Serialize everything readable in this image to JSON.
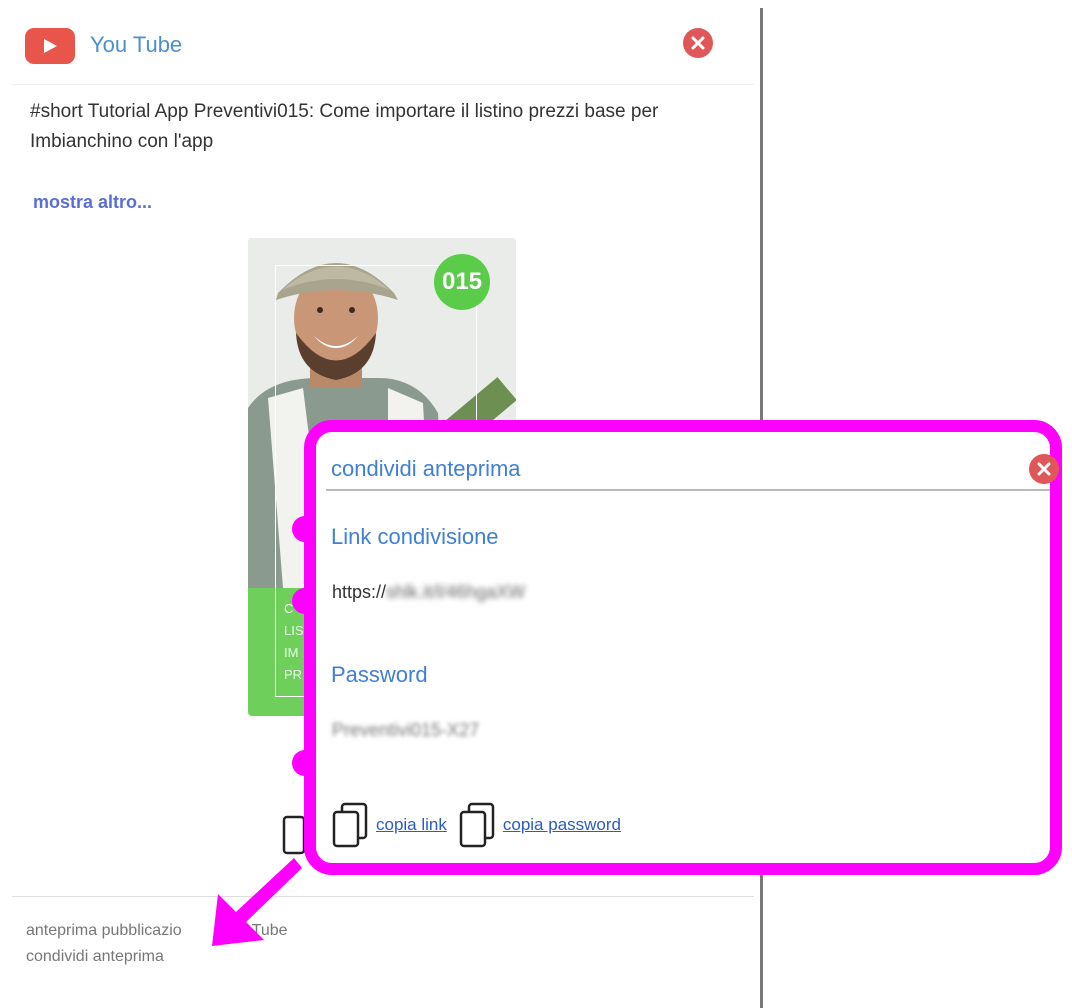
{
  "header": {
    "logo_icon": "youtube-play-icon",
    "title": "You Tube"
  },
  "post": {
    "text": "#short Tutorial App Preventivi015: Come importare il listino prezzi base per Imbianchino con l'app",
    "show_more": "mostra altro..."
  },
  "thumbnail": {
    "badge": "015",
    "overlay_lines": [
      "C",
      "LIS",
      "IM",
      "PR"
    ]
  },
  "footer": {
    "line1": "anteprima pubblicazione You Tube",
    "line1_visible_start": "anteprima pubblicazio",
    "line1_visible_end": "Tube",
    "line2": "condividi anteprima"
  },
  "popup": {
    "title": "condividi anteprima",
    "link_label": "Link condivisione",
    "link_value_prefix": "https://",
    "link_value_rest": "shlk.it/l/46hgaXW",
    "password_label": "Password",
    "password_value": "Preventivi015-X27",
    "copy_link": "copia link",
    "copy_password": "copia password"
  },
  "colors": {
    "accent_blue": "#3f7fd6",
    "highlight_magenta": "#ff00ff",
    "close_red": "#e0575a",
    "youtube_red": "#e8554a",
    "brand_green": "#6ed05a"
  }
}
